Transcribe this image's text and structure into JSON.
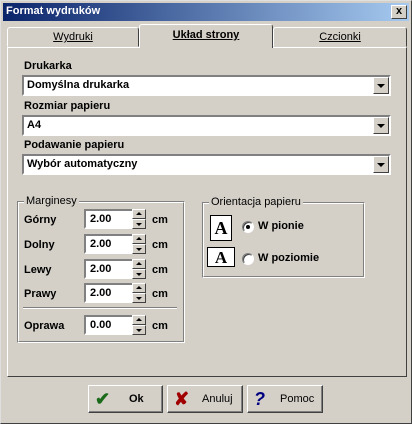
{
  "window": {
    "title": "Format wydruków",
    "close_label": "x"
  },
  "tabs": [
    {
      "label": "Wydruki"
    },
    {
      "label": "Układ strony"
    },
    {
      "label": "Czcionki"
    }
  ],
  "printer": {
    "label": "Drukarka",
    "value": "Domyślna drukarka"
  },
  "paper_size": {
    "label": "Rozmiar papieru",
    "value": "A4"
  },
  "paper_feed": {
    "label": "Podawanie papieru",
    "value": "Wybór automatyczny"
  },
  "margins": {
    "title": "Marginesy",
    "unit": "cm",
    "top": {
      "label": "Górny",
      "value": "2.00"
    },
    "bottom": {
      "label": "Dolny",
      "value": "2.00"
    },
    "left": {
      "label": "Lewy",
      "value": "2.00"
    },
    "right": {
      "label": "Prawy",
      "value": "2.00"
    },
    "binding": {
      "label": "Oprawa",
      "value": "0.00"
    }
  },
  "orientation": {
    "title": "Orientacja papieru",
    "icon_glyph": "A",
    "portrait": {
      "label": "W pionie",
      "selected": true
    },
    "landscape": {
      "label": "W poziomie",
      "selected": false
    }
  },
  "buttons": {
    "ok": {
      "label": "Ok",
      "icon": "checkmark-icon"
    },
    "cancel": {
      "label": "Anuluj",
      "icon": "x-mark-icon"
    },
    "help": {
      "label": "Pomoc",
      "icon": "question-mark-icon"
    }
  },
  "colors": {
    "titlebar_start": "#0a246a",
    "titlebar_end": "#a6caf0",
    "ok_icon": "#1a6a1a",
    "cancel_icon": "#a00000",
    "help_icon": "#000080"
  }
}
